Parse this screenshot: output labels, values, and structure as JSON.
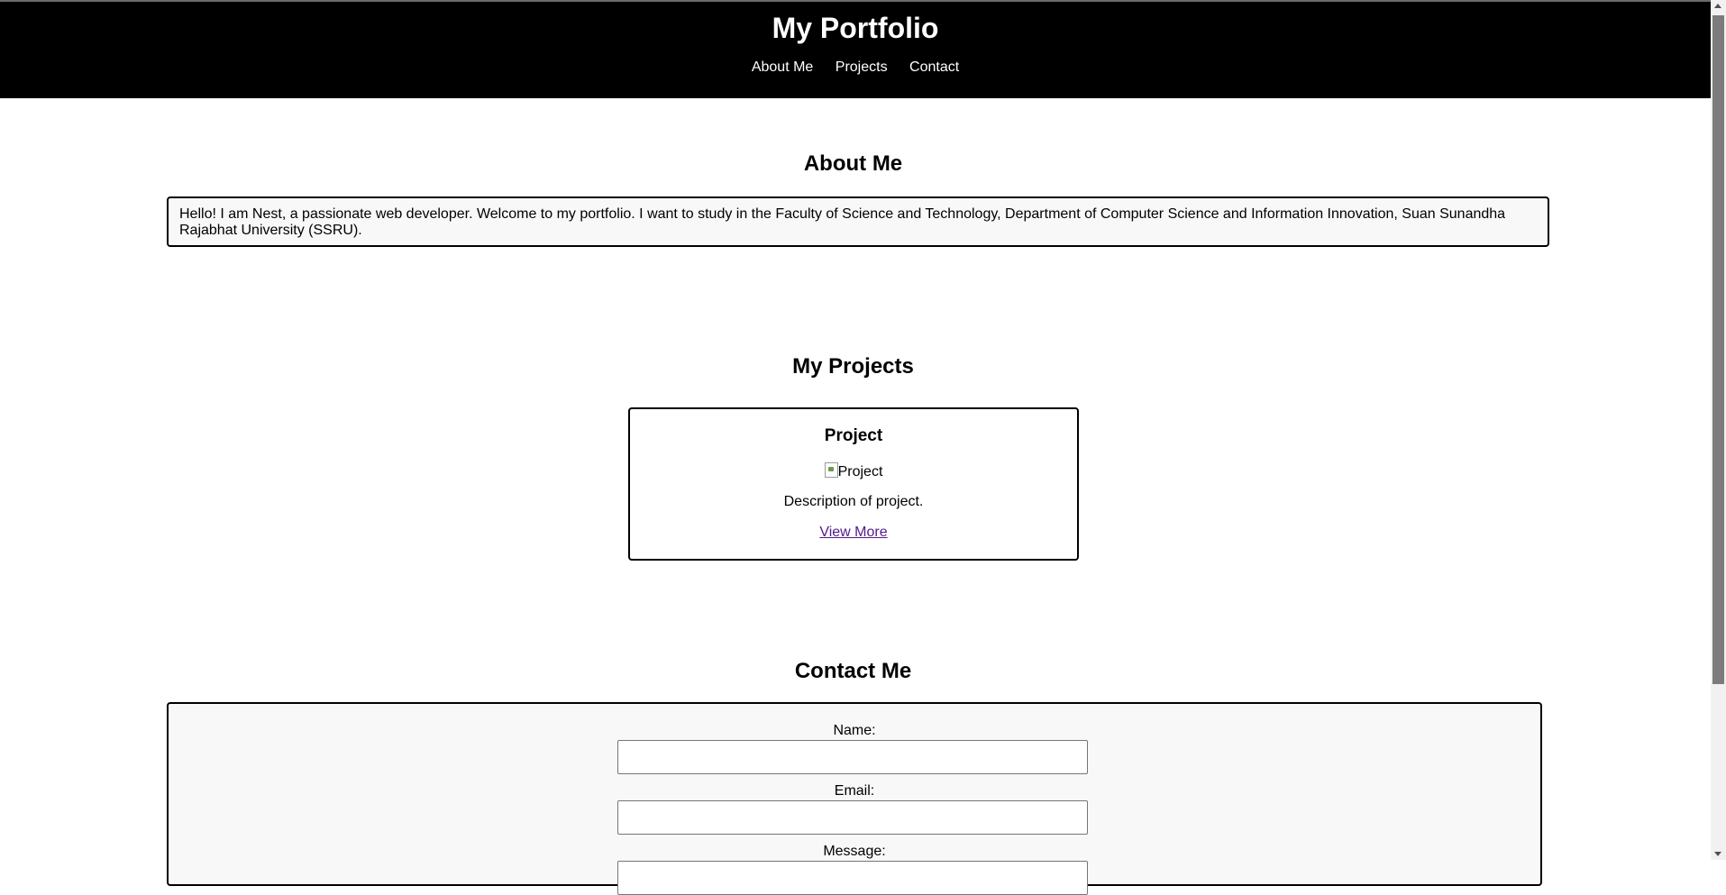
{
  "header": {
    "title": "My Portfolio",
    "nav": [
      "About Me",
      "Projects",
      "Contact"
    ]
  },
  "about": {
    "heading": "About Me",
    "text": "Hello! I am Nest, a passionate web developer. Welcome to my portfolio. I want to study in the Faculty of Science and Technology, Department of Computer Science and Information Innovation, Suan Sunandha Rajabhat University (SSRU)."
  },
  "projects": {
    "heading": "My Projects",
    "items": [
      {
        "title": "Project",
        "image_alt": "Project",
        "description": "Description of project.",
        "link_label": "View More"
      }
    ]
  },
  "contact": {
    "heading": "Contact Me",
    "fields": [
      {
        "label": "Name:",
        "value": ""
      },
      {
        "label": "Email:",
        "value": ""
      },
      {
        "label": "Message:",
        "value": ""
      }
    ]
  },
  "colors": {
    "header_bg": "#000000",
    "link_visited": "#551a8b",
    "box_bg": "#f8f8f8"
  }
}
